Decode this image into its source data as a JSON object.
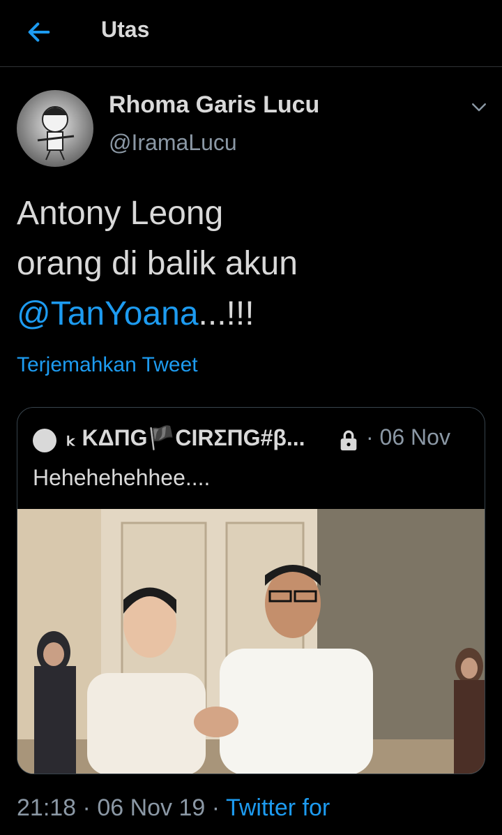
{
  "header": {
    "title": "Utas",
    "back_icon": "arrow-left-icon"
  },
  "tweet": {
    "display_name": "Rhoma Garis Lucu",
    "handle": "@IramaLucu",
    "text_line1": "Antony Leong",
    "text_line2": "orang di balik akun",
    "mention": "@TanYoana",
    "mention_suffix": "...!!!",
    "translate_label": "Terjemahkan Tweet",
    "time": "21:18",
    "date": "06 Nov 19",
    "separator": "·",
    "source": "Twitter for"
  },
  "quoted_tweet": {
    "display_name": "ₖ KΔПG🏴CIRΣПG#β...",
    "locked": true,
    "separator": "·",
    "date": "06 Nov",
    "text": "Hehehehehhee....",
    "lock_icon": "lock-icon"
  },
  "colors": {
    "background": "#000000",
    "text": "#d9d9d9",
    "secondary": "#8b98a5",
    "accent": "#1d9bf0",
    "border": "#38444d"
  }
}
